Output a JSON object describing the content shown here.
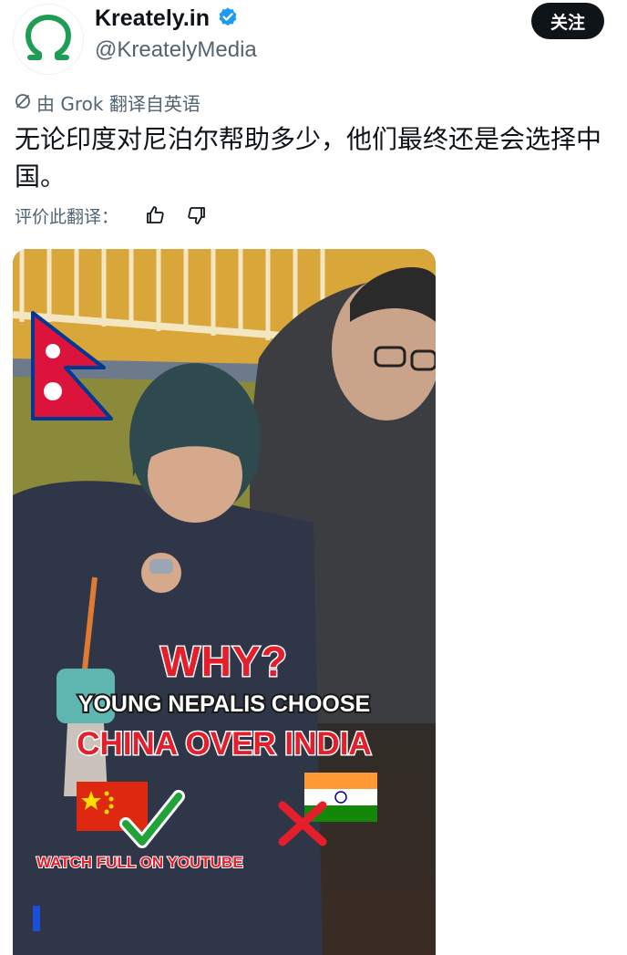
{
  "header": {
    "display_name": "Kreately.in",
    "handle": "@KreatelyMedia",
    "follow_label": "关注"
  },
  "translation": {
    "note": "由 Grok 翻译自英语",
    "rate_label": "评价此翻译："
  },
  "tweet": {
    "text": "无论印度对尼泊尔帮助多少，他们最终还是会选择中国。"
  },
  "media": {
    "headline": "WHY?",
    "subline": "YOUNG NEPALIS CHOOSE",
    "line3": "CHINA OVER INDIA",
    "cta": "WATCH FULL ON YOUTUBE"
  },
  "colors": {
    "verified": "#1d9bf0",
    "logo_green": "#1f9d55",
    "overlay_red": "#e41e2b",
    "muted": "#536471"
  },
  "icons": {
    "verified": "verified-badge-icon",
    "grok": "grok-icon",
    "thumbs_up": "thumbs-up-icon",
    "thumbs_down": "thumbs-down-icon"
  }
}
